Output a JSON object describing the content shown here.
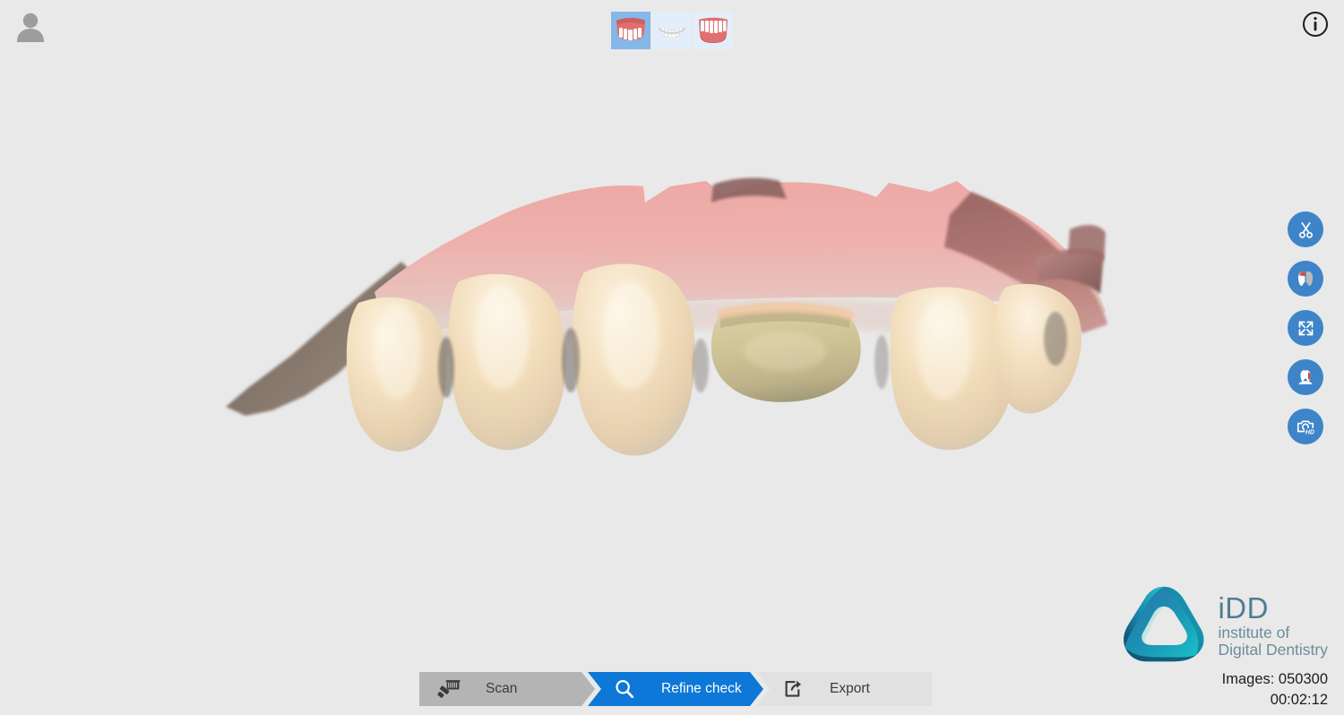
{
  "app": {
    "background_color": "#e9e9e9",
    "accent_color": "#0d78d7",
    "tool_button_color": "#3d85c8"
  },
  "header": {
    "user_icon": "user-avatar-icon",
    "info_icon": "info-circle-icon",
    "info_label": "i"
  },
  "arch_thumbnails": {
    "items": [
      {
        "name": "upper-arch",
        "label": "Upper arch",
        "selected": true
      },
      {
        "name": "bite-arch",
        "label": "Bite",
        "selected": false
      },
      {
        "name": "lower-arch",
        "label": "Lower arch",
        "selected": false
      }
    ]
  },
  "right_toolbar": {
    "items": [
      {
        "name": "trim-tool",
        "icon": "scissors-icon",
        "label": "Trim"
      },
      {
        "name": "color-toggle-tool",
        "icon": "color-monochrome-toggle-icon",
        "label": "Color / monochrome"
      },
      {
        "name": "fit-view-tool",
        "icon": "expand-arrows-icon",
        "label": "Fit to view"
      },
      {
        "name": "tooth-marker-tool",
        "icon": "tooth-marker-icon",
        "label": "Tooth marking"
      },
      {
        "name": "hd-photo-tool",
        "icon": "camera-hd-icon",
        "label": "HD photo"
      }
    ]
  },
  "workflow": {
    "steps": [
      {
        "name": "scan",
        "label": "Scan",
        "icon": "scanner-wand-icon",
        "state": "completed"
      },
      {
        "name": "refine-check",
        "label": "Refine check",
        "icon": "magnifier-icon",
        "state": "active"
      },
      {
        "name": "export",
        "label": "Export",
        "icon": "share-export-icon",
        "state": "pending"
      }
    ]
  },
  "branding": {
    "logo_icon": "idd-triskelion-logo",
    "name": "iDD",
    "line1": "institute of",
    "line2": "Digital Dentistry",
    "logo_color_start": "#1f6fa8",
    "logo_color_end": "#19c3c8"
  },
  "scan_stats": {
    "images": "Images: 050300",
    "elapsed": "00:02:12"
  },
  "model": {
    "description": "Upper arch intraoral scan with prepared tooth",
    "gingiva_color": "#e8a8a4",
    "tooth_color": "#f0ddbe",
    "prep_color": "#c9bd8e",
    "artifact_color": "#7b6a5f"
  }
}
